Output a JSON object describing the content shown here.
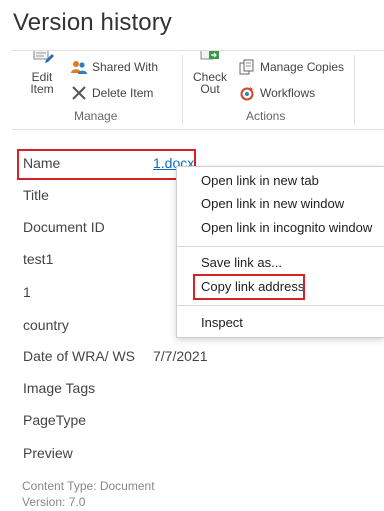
{
  "page": {
    "title": "Version history"
  },
  "ribbon": {
    "manage_group": {
      "label": "Manage",
      "edit_item_label": "Edit\nItem",
      "shared_with_label": "Shared With",
      "delete_item_label": "Delete Item"
    },
    "actions_group": {
      "label": "Actions",
      "check_out_label": "Check\nOut",
      "manage_copies_label": "Manage Copies",
      "workflows_label": "Workflows"
    }
  },
  "properties": [
    {
      "label": "Name",
      "value": "1.docx"
    },
    {
      "label": "Title",
      "value": ""
    },
    {
      "label": "Document ID",
      "value": ""
    },
    {
      "label": "test1",
      "value": ""
    },
    {
      "label": "1",
      "value": ""
    },
    {
      "label": "country",
      "value": ""
    },
    {
      "label": "Date of WRA/ WS",
      "value": "7/7/2021"
    },
    {
      "label": "Image Tags",
      "value": ""
    },
    {
      "label": "PageType",
      "value": ""
    },
    {
      "label": "Preview",
      "value": ""
    }
  ],
  "footer": {
    "content_type": "Content Type: Document",
    "version": "Version: 7.0"
  },
  "context_menu": {
    "items": [
      "Open link in new tab",
      "Open link in new window",
      "Open link in incognito window",
      "Save link as...",
      "Copy link address",
      "Inspect"
    ]
  },
  "colors": {
    "highlight": "#d42027",
    "link": "#0f6cbd"
  }
}
